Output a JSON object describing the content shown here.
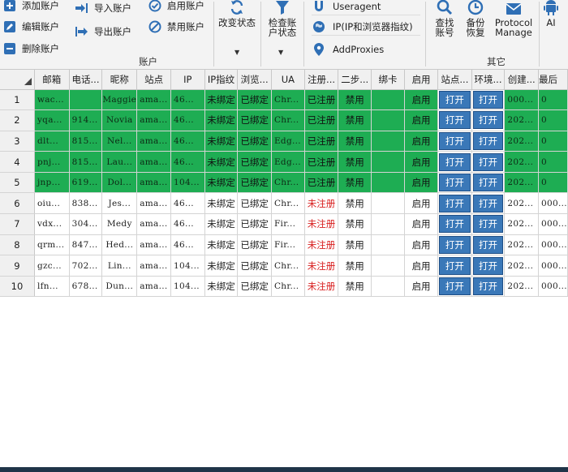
{
  "ribbon": {
    "account_group": {
      "label": "账户",
      "add": "添加账户",
      "edit": "编辑账户",
      "delete": "删除账户",
      "import": "导入账户",
      "export": "导出账户",
      "enable": "启用账户",
      "disable": "禁用账户",
      "change_status": "改变状态",
      "check_status": "检查账户状态"
    },
    "middle": {
      "useragent": "Useragent",
      "ip_fingerprint": "IP(IP和浏览器指纹)",
      "add_proxies": "AddProxies"
    },
    "other_group": {
      "label": "其它",
      "find_account": "查找账号",
      "backup_restore": "备份恢复",
      "protocol_manage": "Protocol Manage",
      "ai": "AI"
    }
  },
  "table": {
    "columns": [
      "",
      "邮箱",
      "电话...",
      "昵称",
      "站点",
      "IP",
      "IP指纹",
      "浏览...",
      "UA",
      "注册...",
      "二步...",
      "绑卡",
      "启用",
      "站点...",
      "环境...",
      "创建...",
      "最后"
    ],
    "rows": [
      {
        "n": "1",
        "email": "wac...",
        "phone": "",
        "nick": "Maggie",
        "site": "ama...",
        "ip": "46...",
        "ipfp": "未绑定",
        "browser": "已绑定",
        "ua": "Chr...",
        "reg": "已注册",
        "twostep": "禁用",
        "card": "",
        "enabled": "启用",
        "siteopen": "打开",
        "envopen": "打开",
        "created": "000...",
        "last": "0",
        "green": true,
        "registered": true
      },
      {
        "n": "2",
        "email": "yqa...",
        "phone": "914...",
        "nick": "Novia",
        "site": "ama...",
        "ip": "46...",
        "ipfp": "未绑定",
        "browser": "已绑定",
        "ua": "Chr...",
        "reg": "已注册",
        "twostep": "禁用",
        "card": "",
        "enabled": "启用",
        "siteopen": "打开",
        "envopen": "打开",
        "created": "202...",
        "last": "0",
        "green": true,
        "registered": true
      },
      {
        "n": "3",
        "email": "dlt...",
        "phone": "815...",
        "nick": "Nel...",
        "site": "ama...",
        "ip": "46...",
        "ipfp": "未绑定",
        "browser": "已绑定",
        "ua": "Edg...",
        "reg": "已注册",
        "twostep": "禁用",
        "card": "",
        "enabled": "启用",
        "siteopen": "打开",
        "envopen": "打开",
        "created": "202...",
        "last": "0",
        "green": true,
        "registered": true
      },
      {
        "n": "4",
        "email": "pnj...",
        "phone": "815...",
        "nick": "Lau...",
        "site": "ama...",
        "ip": "46...",
        "ipfp": "未绑定",
        "browser": "已绑定",
        "ua": "Edg...",
        "reg": "已注册",
        "twostep": "禁用",
        "card": "",
        "enabled": "启用",
        "siteopen": "打开",
        "envopen": "打开",
        "created": "202...",
        "last": "0",
        "green": true,
        "registered": true
      },
      {
        "n": "5",
        "email": "jnp...",
        "phone": "619...",
        "nick": "Dol...",
        "site": "ama...",
        "ip": "104...",
        "ipfp": "未绑定",
        "browser": "已绑定",
        "ua": "Chr...",
        "reg": "已注册",
        "twostep": "禁用",
        "card": "",
        "enabled": "启用",
        "siteopen": "打开",
        "envopen": "打开",
        "created": "202...",
        "last": "0",
        "green": true,
        "registered": true
      },
      {
        "n": "6",
        "email": "oiu...",
        "phone": "838...",
        "nick": "Jes...",
        "site": "ama...",
        "ip": "46...",
        "ipfp": "未绑定",
        "browser": "已绑定",
        "ua": "Chr...",
        "reg": "未注册",
        "twostep": "禁用",
        "card": "",
        "enabled": "启用",
        "siteopen": "打开",
        "envopen": "打开",
        "created": "202...",
        "last": "000...",
        "green": false,
        "registered": false
      },
      {
        "n": "7",
        "email": "vdx...",
        "phone": "304...",
        "nick": "Medy",
        "site": "ama...",
        "ip": "46...",
        "ipfp": "未绑定",
        "browser": "已绑定",
        "ua": "Fir...",
        "reg": "未注册",
        "twostep": "禁用",
        "card": "",
        "enabled": "启用",
        "siteopen": "打开",
        "envopen": "打开",
        "created": "202...",
        "last": "000...",
        "green": false,
        "registered": false
      },
      {
        "n": "8",
        "email": "qrm...",
        "phone": "847...",
        "nick": "Hed...",
        "site": "ama...",
        "ip": "46...",
        "ipfp": "未绑定",
        "browser": "已绑定",
        "ua": "Fir...",
        "reg": "未注册",
        "twostep": "禁用",
        "card": "",
        "enabled": "启用",
        "siteopen": "打开",
        "envopen": "打开",
        "created": "202...",
        "last": "000...",
        "green": false,
        "registered": false
      },
      {
        "n": "9",
        "email": "gzc...",
        "phone": "702...",
        "nick": "Lin...",
        "site": "ama...",
        "ip": "104...",
        "ipfp": "未绑定",
        "browser": "已绑定",
        "ua": "Chr...",
        "reg": "未注册",
        "twostep": "禁用",
        "card": "",
        "enabled": "启用",
        "siteopen": "打开",
        "envopen": "打开",
        "created": "202...",
        "last": "000...",
        "green": false,
        "registered": false
      },
      {
        "n": "10",
        "email": "lfn...",
        "phone": "678...",
        "nick": "Dun...",
        "site": "ama...",
        "ip": "104...",
        "ipfp": "未绑定",
        "browser": "已绑定",
        "ua": "Chr...",
        "reg": "未注册",
        "twostep": "禁用",
        "card": "",
        "enabled": "启用",
        "siteopen": "打开",
        "envopen": "打开",
        "created": "202...",
        "last": "000...",
        "green": false,
        "registered": false
      }
    ]
  },
  "colors": {
    "row_green": "#1ead53",
    "open_button": "#3a78b8",
    "ribbon_icon": "#2f6fb5",
    "not_registered": "#d81e1e"
  }
}
